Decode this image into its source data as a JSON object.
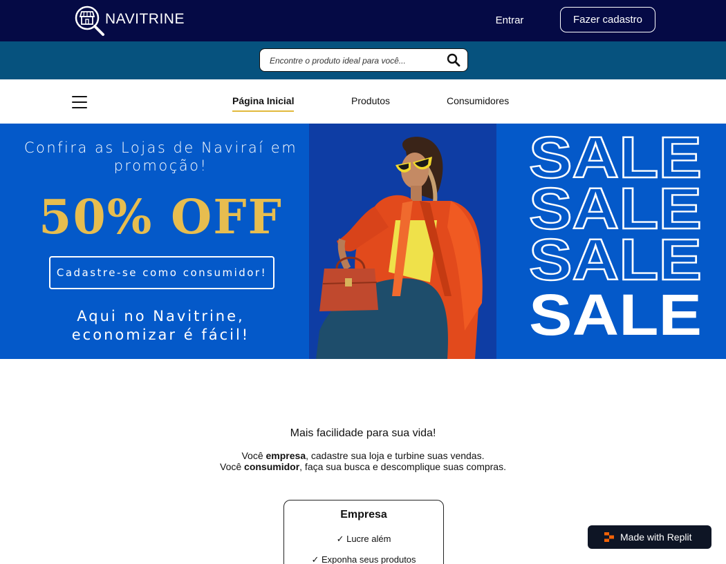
{
  "header": {
    "brand": "NAVITRINE",
    "login_label": "Entrar",
    "signup_label": "Fazer cadastro"
  },
  "search": {
    "placeholder": "Encontre o produto ideal para você..."
  },
  "nav": {
    "items": [
      {
        "label": "Página Inicial",
        "active": true
      },
      {
        "label": "Produtos",
        "active": false
      },
      {
        "label": "Consumidores",
        "active": false
      }
    ]
  },
  "banner": {
    "title": "Confira as Lojas de Naviraí em promoção!",
    "discount": "50% OFF",
    "cta_label": "Cadastre-se como consumidor!",
    "tagline_1": "Aqui no Navitrine,",
    "tagline_2": "economizar é fácil!",
    "sale_word": "SALE"
  },
  "content": {
    "headline": "Mais facilidade para sua vida!",
    "line1_pre": "Você ",
    "line1_bold": "empresa",
    "line1_post": ", cadastre sua loja e turbine suas vendas.",
    "line2_pre": "Você ",
    "line2_bold": "consumidor",
    "line2_post": ", faça sua busca e descomplique suas compras."
  },
  "card": {
    "title": "Empresa",
    "items": [
      "✓ Lucre além",
      "✓ Exponha seus produtos"
    ]
  },
  "badge": {
    "label": "Made with Replit"
  },
  "colors": {
    "topbar": "#050a45",
    "searchbar": "#06527e",
    "banner": "#0459c9",
    "gold": "#e7bd4f",
    "nav_underline": "#e2b93b"
  }
}
